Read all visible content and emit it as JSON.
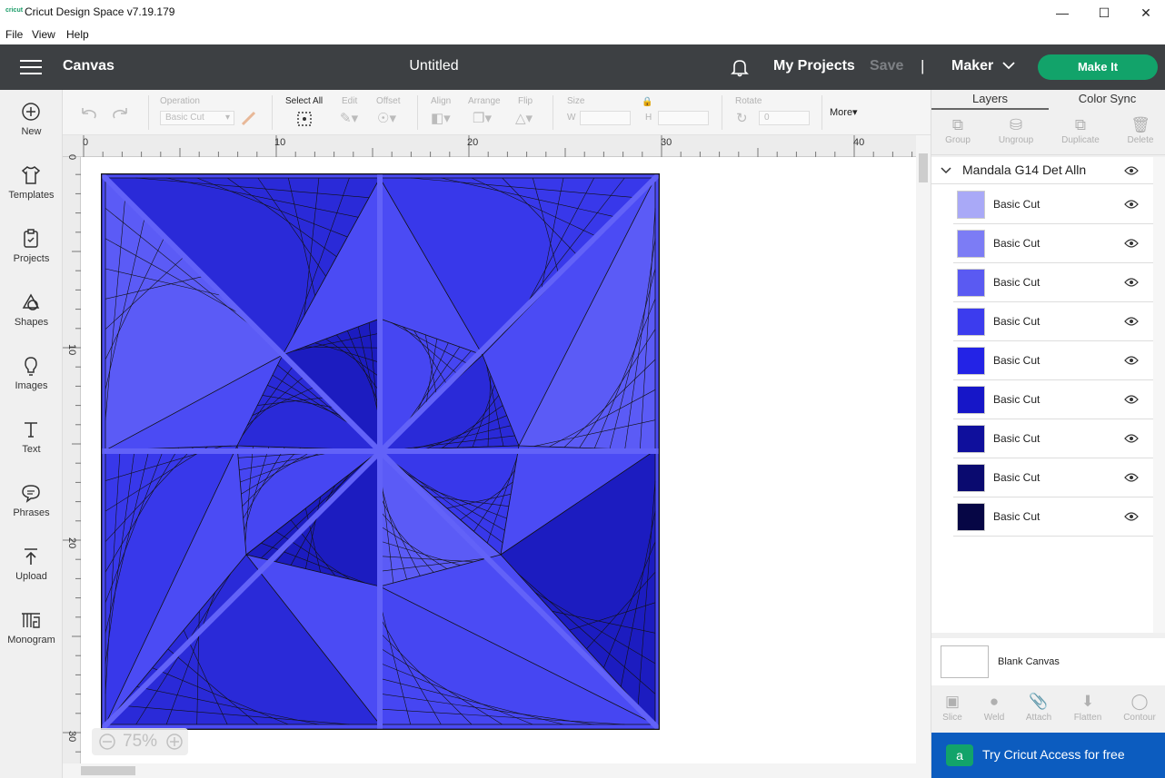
{
  "window": {
    "title": "Cricut Design Space  v7.19.179",
    "logo": "cricut"
  },
  "menu": [
    "File",
    "View",
    "Help"
  ],
  "appbar": {
    "section": "Canvas",
    "doc_title": "Untitled",
    "my_projects": "My Projects",
    "save": "Save",
    "separator": "|",
    "machine": "Maker",
    "make_it": "Make It"
  },
  "leftnav": [
    {
      "label": "New",
      "icon": "plus-circle-icon"
    },
    {
      "label": "Templates",
      "icon": "shirt-icon"
    },
    {
      "label": "Projects",
      "icon": "projects-icon"
    },
    {
      "label": "Shapes",
      "icon": "shapes-icon"
    },
    {
      "label": "Images",
      "icon": "lightbulb-icon"
    },
    {
      "label": "Text",
      "icon": "text-icon"
    },
    {
      "label": "Phrases",
      "icon": "speech-bubble-icon"
    },
    {
      "label": "Upload",
      "icon": "upload-icon"
    },
    {
      "label": "Monogram",
      "icon": "monogram-icon"
    }
  ],
  "toolbar": {
    "operation_label": "Operation",
    "operation_value": "Basic Cut",
    "select_all": "Select All",
    "edit": "Edit",
    "offset": "Offset",
    "align": "Align",
    "arrange": "Arrange",
    "flip": "Flip",
    "size": "Size",
    "w": "W",
    "h": "H",
    "rotate": "Rotate",
    "rotate_value": "0",
    "more": "More▾"
  },
  "ruler": {
    "h": [
      "0",
      "10",
      "20",
      "30",
      "40"
    ],
    "v": [
      "0",
      "10",
      "20",
      "30"
    ]
  },
  "zoom": "75%",
  "canvas_image": {
    "fill": "#4b4bf4",
    "dark": "#1a1ac8",
    "stroke": "#111"
  },
  "rightpanel": {
    "tabs": [
      "Layers",
      "Color Sync"
    ],
    "tools": [
      "Group",
      "Ungroup",
      "Duplicate",
      "Delete"
    ],
    "group_name": "Mandala G14 Det Alln",
    "layers": [
      {
        "name": "Basic Cut",
        "color": "#a9a9f7"
      },
      {
        "name": "Basic Cut",
        "color": "#7c7cf5"
      },
      {
        "name": "Basic Cut",
        "color": "#5a5af2"
      },
      {
        "name": "Basic Cut",
        "color": "#3c3cee"
      },
      {
        "name": "Basic Cut",
        "color": "#2323e6"
      },
      {
        "name": "Basic Cut",
        "color": "#1616c8"
      },
      {
        "name": "Basic Cut",
        "color": "#0f0f9c"
      },
      {
        "name": "Basic Cut",
        "color": "#0a0a6f"
      },
      {
        "name": "Basic Cut",
        "color": "#060645"
      }
    ],
    "blank_canvas": "Blank Canvas",
    "bottom_tools": [
      "Slice",
      "Weld",
      "Attach",
      "Flatten",
      "Contour"
    ],
    "access": "Try Cricut Access for free",
    "access_badge": "a"
  },
  "colors": {
    "appbar": "#3d4043",
    "make_it": "#12a36a",
    "access": "#0c5cbf"
  }
}
